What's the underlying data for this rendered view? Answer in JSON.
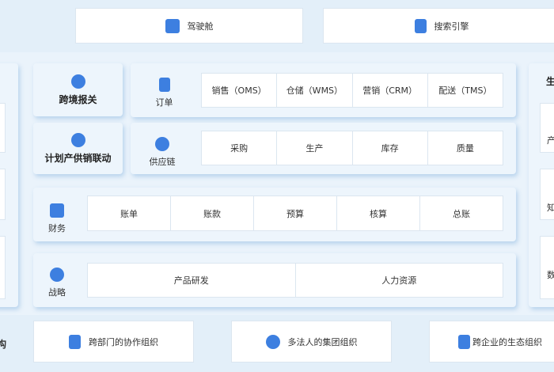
{
  "top": {
    "cockpit": "驾驶舱",
    "search_engine": "搜索引擎"
  },
  "features": {
    "cross_border": "跨境报关",
    "planning": "计划产供销联动"
  },
  "order": {
    "label": "订单",
    "items": [
      "销售（OMS）",
      "仓储（WMS）",
      "营销（CRM）",
      "配送（TMS）"
    ]
  },
  "supply": {
    "label": "供应链",
    "items": [
      "采购",
      "生产",
      "库存",
      "质量"
    ]
  },
  "finance": {
    "label": "财务",
    "items": [
      "账单",
      "账款",
      "预算",
      "核算",
      "总账"
    ]
  },
  "strategy": {
    "label": "战略",
    "items": [
      "产品研发",
      "人力资源"
    ]
  },
  "right_partial": [
    "生",
    "产",
    "知",
    "数"
  ],
  "left_partial": "构",
  "bottom": [
    "跨部门的协作组织",
    "多法人的集团组织",
    "跨企业的生态组织"
  ],
  "accent": "#3d7fe0"
}
